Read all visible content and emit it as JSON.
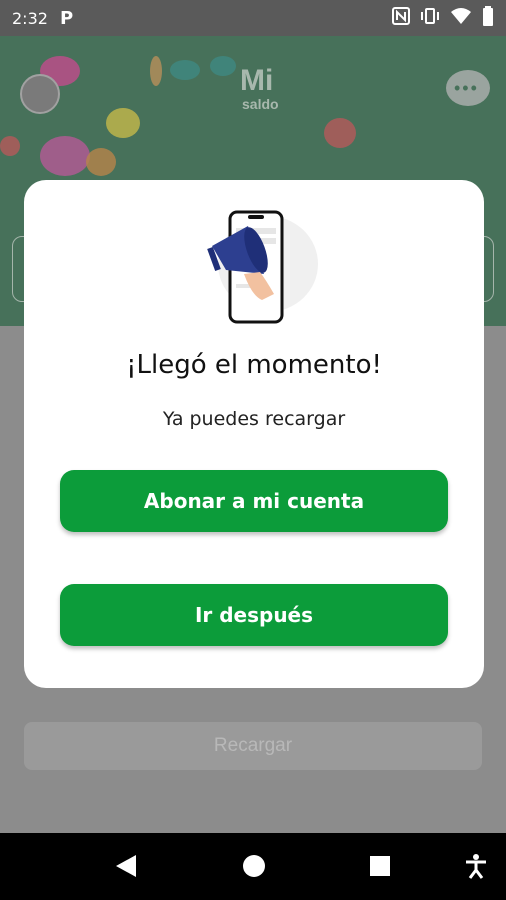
{
  "status_bar": {
    "time": "2:32",
    "app_indicator": "P",
    "icons": [
      "nfc-icon",
      "vibrate-icon",
      "wifi-icon",
      "battery-icon"
    ]
  },
  "header": {
    "logo_line1": "Mi",
    "logo_line2": "saldo"
  },
  "modal": {
    "title": "¡Llegó el momento!",
    "subtitle": "Ya puedes recargar",
    "primary_button": "Abonar a mi cuenta",
    "secondary_button": "Ir después"
  },
  "background": {
    "recargar_label": "Recargar"
  },
  "colors": {
    "accent": "#0c9c3a",
    "header_green": "#47715a",
    "overlay": "#8c8c8c"
  },
  "nav_bar": {
    "icons": [
      "back-icon",
      "home-icon",
      "recents-icon",
      "accessibility-icon"
    ]
  }
}
